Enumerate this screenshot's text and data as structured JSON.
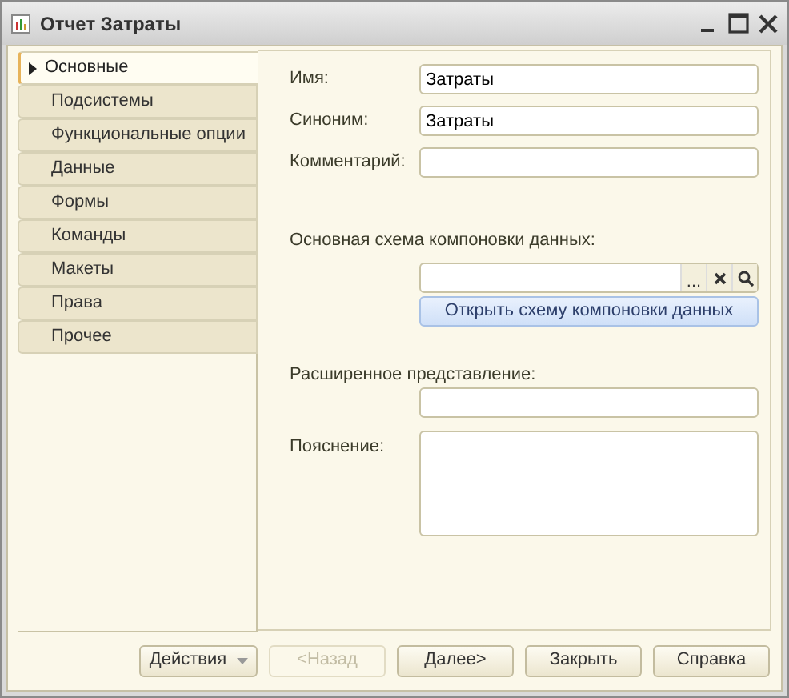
{
  "window": {
    "title": "Отчет Затраты"
  },
  "tabs": [
    {
      "label": "Основные",
      "selected": true
    },
    {
      "label": "Подсистемы",
      "selected": false
    },
    {
      "label": "Функциональные опции",
      "selected": false
    },
    {
      "label": "Данные",
      "selected": false
    },
    {
      "label": "Формы",
      "selected": false
    },
    {
      "label": "Команды",
      "selected": false
    },
    {
      "label": "Макеты",
      "selected": false
    },
    {
      "label": "Права",
      "selected": false
    },
    {
      "label": "Прочее",
      "selected": false
    }
  ],
  "fields": {
    "name": {
      "label": "Имя:",
      "value": "Затраты"
    },
    "synonym": {
      "label": "Синоним:",
      "value": "Затраты"
    },
    "comment": {
      "label": "Комментарий:"
    }
  },
  "schema": {
    "label": "Основная схема компоновки данных:",
    "select_button": "...",
    "open_button": "Открыть схему компоновки данных"
  },
  "extended": {
    "label": "Расширенное представление:"
  },
  "explanation": {
    "label": "Пояснение:"
  },
  "buttons": [
    {
      "label": "Действия",
      "kind": "menu",
      "disabled": false
    },
    {
      "label": "<Назад",
      "kind": "plain",
      "disabled": true
    },
    {
      "label": "Далее>",
      "kind": "plain",
      "disabled": false
    },
    {
      "label": "Закрыть",
      "kind": "plain",
      "disabled": false
    },
    {
      "label": "Справка",
      "kind": "plain",
      "disabled": false
    }
  ]
}
